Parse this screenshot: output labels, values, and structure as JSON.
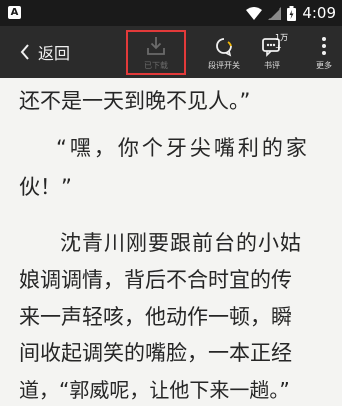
{
  "status_bar": {
    "notification_badge": "A",
    "time": "4:09"
  },
  "toolbar": {
    "back_label": "返回",
    "download_label": "已下载",
    "comment_toggle_label": "段评开关",
    "book_review_label": "书评",
    "book_review_count": "1万+",
    "more_label": "更多"
  },
  "content": {
    "lines": [
      "还不是一天到晚不见人。”",
      "“嘿，你个牙尖嘴利的家",
      "伙！”",
      "沈青川刚要跟前台的小姑",
      "娘调调情，背后不合时宜的传",
      "来一声轻咳，他动作一顿，瞬",
      "间收起调笑的嘴脸，一本正经",
      "道，“郭威呢，让他下来一趟。”"
    ]
  },
  "colors": {
    "toolbar_bg": "#2b2b2b",
    "page_bg": "#f4f4f2",
    "highlight": "#e23a3a",
    "text": "#262626",
    "accent_ring": "#f2b705"
  }
}
